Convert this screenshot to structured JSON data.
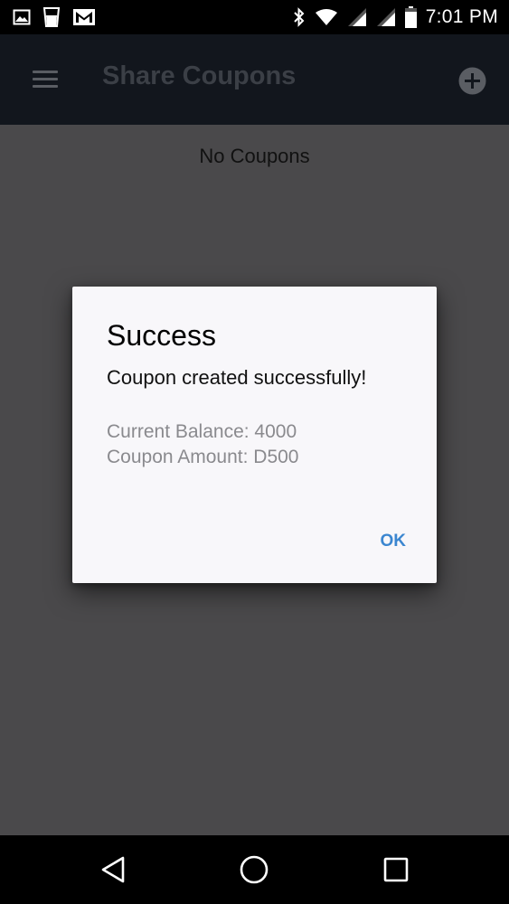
{
  "status_bar": {
    "time": "7:01 PM",
    "left_icons": [
      "image-icon",
      "cup-icon",
      "gmail-icon"
    ],
    "right_icons": [
      "bluetooth-icon",
      "wifi-icon",
      "signal-icon",
      "signal-icon",
      "battery-icon"
    ]
  },
  "app_bar": {
    "title": "Share Coupons",
    "menu_icon": "menu-icon",
    "add_icon": "add-circle-icon"
  },
  "content": {
    "empty_text": "No Coupons"
  },
  "dialog": {
    "title": "Success",
    "message": "Coupon created successfully!",
    "balance_line": "Current Balance: 4000",
    "amount_line": "Coupon Amount: D500",
    "ok_label": "OK"
  },
  "nav_bar": {
    "buttons": [
      "back-icon",
      "home-icon",
      "recents-icon"
    ]
  },
  "colors": {
    "accent": "#3b86d0",
    "scrim": "#4a494b",
    "app_bar": "#12161d",
    "dialog_bg": "#f8f7fa",
    "secondary_text": "#8a8a8e"
  }
}
